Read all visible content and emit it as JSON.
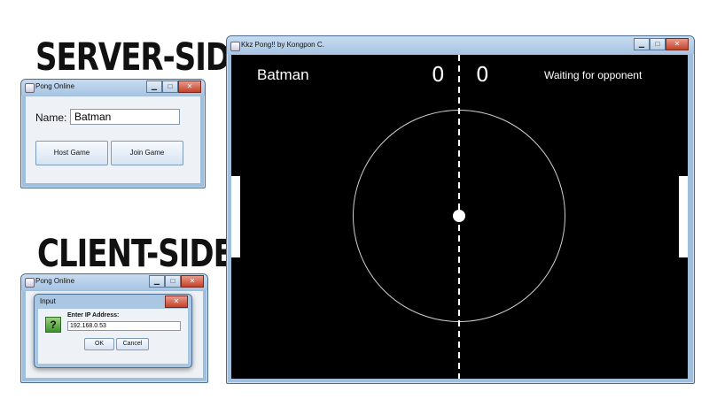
{
  "labels": {
    "server_side": "SERVER-SIDE",
    "client_side": "CLIENT-SIDE"
  },
  "server_window": {
    "title": "Pong Online",
    "name_label": "Name:",
    "name_value": "Batman",
    "host_button": "Host Game",
    "join_button": "Join Game"
  },
  "client_window": {
    "title": "Pong Online",
    "dialog": {
      "title": "Input",
      "icon": "question-icon",
      "icon_glyph": "?",
      "prompt": "Enter IP Address:",
      "ip_value": "192.168.0.53",
      "ok_button": "OK",
      "cancel_button": "Cancel"
    }
  },
  "pong_window": {
    "title": "Kkz Pong!! by Kongpon C.",
    "player_name": "Batman",
    "left_score": "0",
    "right_score": "0",
    "status": "Waiting for opponent"
  },
  "window_controls": {
    "minimize": "▁",
    "maximize": "□",
    "close": "✕"
  },
  "colors": {
    "background": "#000000",
    "foreground": "#ffffff",
    "frame": "#9fbfdd"
  }
}
